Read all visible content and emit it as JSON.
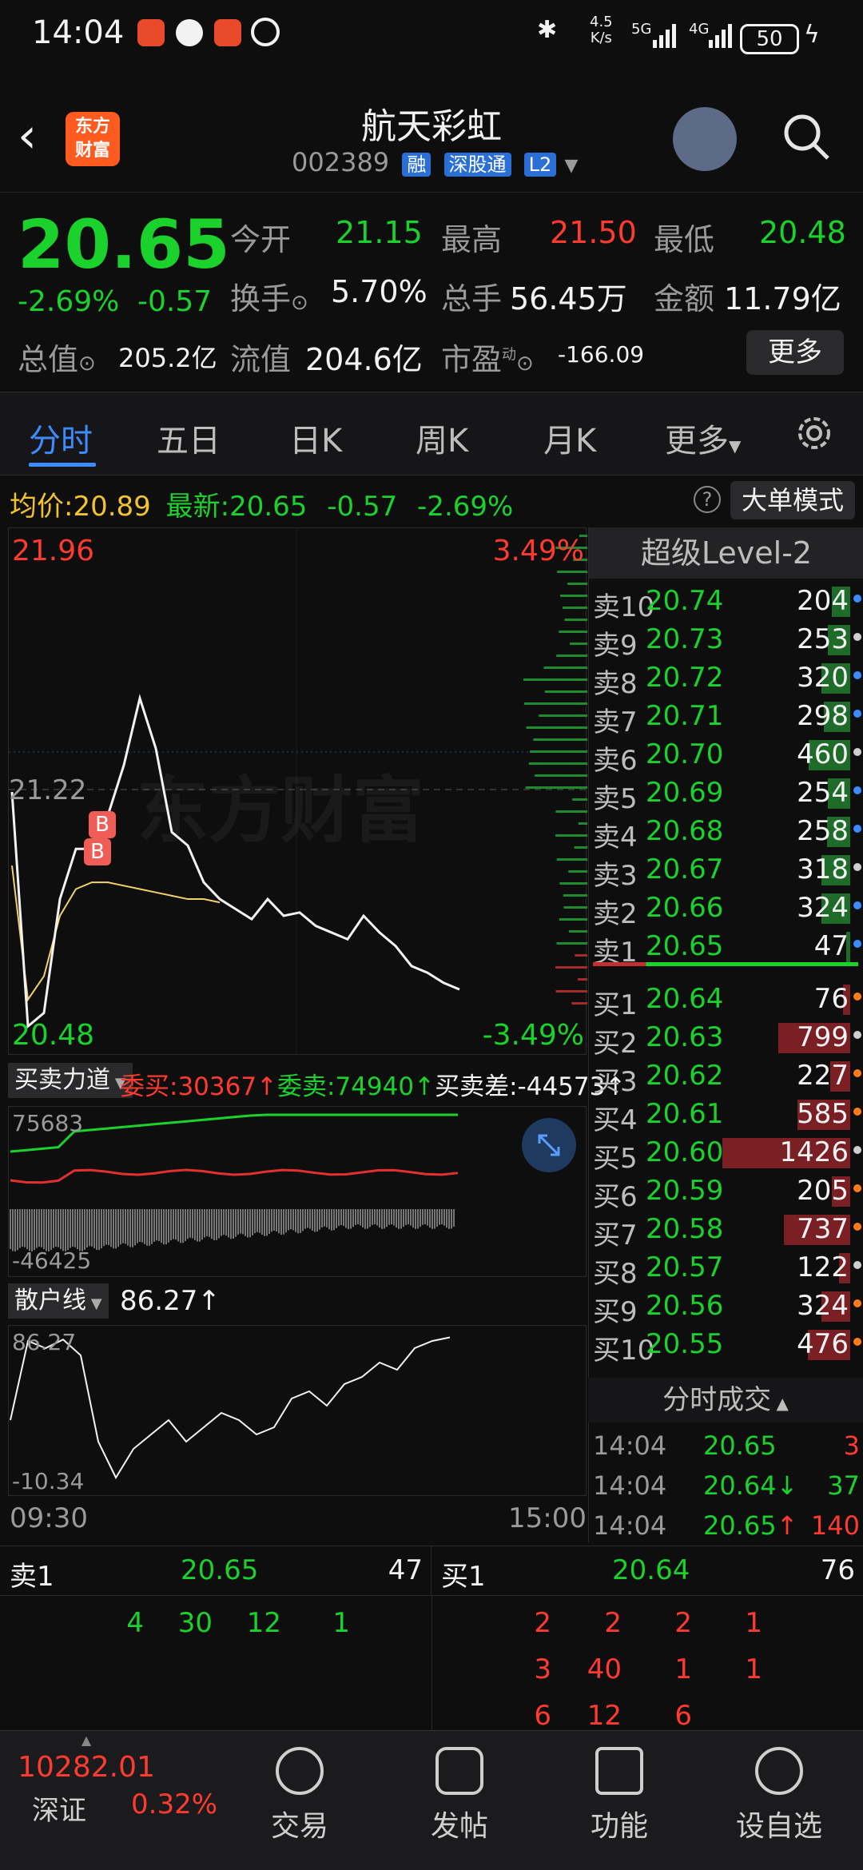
{
  "status_bar": {
    "time": "14:04",
    "speed_value": "4.5",
    "speed_unit": "K/s",
    "net1": "5G",
    "net2": "4G",
    "battery": "50"
  },
  "header": {
    "title": "航天彩虹",
    "code": "002389",
    "tag_rong": "融",
    "tag_sgt": "深股通",
    "tag_level": "L2",
    "logo_line1": "东方",
    "logo_line2": "财富"
  },
  "quote": {
    "price": "20.65",
    "change_pct": "-2.69%",
    "change": "-0.57",
    "open_label": "今开",
    "open": "21.15",
    "high_label": "最高",
    "high": "21.50",
    "low_label": "最低",
    "low": "20.48",
    "turnover_label": "换手",
    "turnover": "5.70%",
    "volume_label": "总手",
    "volume": "56.45万",
    "amount_label": "金额",
    "amount": "11.79亿",
    "mcap_label": "总值",
    "mcap": "205.2亿",
    "float_label": "流值",
    "float": "204.6亿",
    "pe_label": "市盈",
    "pe_sup": "动",
    "pe": "-166.09",
    "more": "更多"
  },
  "tabs": [
    "分时",
    "五日",
    "日K",
    "周K",
    "月K",
    "更多"
  ],
  "infobar": {
    "avg_label": "均价:",
    "avg": "20.89",
    "latest_label": "最新:",
    "latest": "20.65",
    "chg": "-0.57",
    "chg_pct": "-2.69%",
    "mode": "大单模式"
  },
  "chart": {
    "y_max": "21.96",
    "y_min": "20.48",
    "y_mid": "21.22",
    "pct_max": "3.49%",
    "pct_min": "-3.49%",
    "watermark": "东方财富",
    "marker1": "B",
    "marker2": "B",
    "time_start": "09:30",
    "time_end": "15:00",
    "force_label": "买卖力道",
    "wei_buy": "委买:30367↑",
    "wei_sell": "委卖:74940↑",
    "diff": "买卖差:-44573↑",
    "force_max": "75683",
    "force_min": "-46425",
    "retail_label": "散户线",
    "retail_val": "86.27↑",
    "retail_max": "86.27",
    "retail_min": "-10.34"
  },
  "chart_data": {
    "type": "line",
    "x_range": [
      "09:30",
      "15:00"
    ],
    "ylim": [
      20.48,
      21.96
    ],
    "y_mid": 21.22,
    "series": [
      {
        "values": [
          21.22,
          20.52,
          20.56,
          20.9,
          21.05,
          21.05,
          21.15,
          21.3,
          21.5,
          21.35,
          21.1,
          21.06,
          20.95,
          20.9,
          20.87,
          20.84,
          20.9,
          20.85,
          20.86,
          20.82,
          20.8,
          20.78,
          20.85,
          20.8,
          20.76,
          20.7,
          20.68,
          20.65,
          20.63
        ]
      },
      {
        "values": [
          21.0,
          20.6,
          20.67,
          20.85,
          20.93,
          20.95,
          20.95,
          20.94,
          20.93,
          20.92,
          20.91,
          20.9,
          20.9,
          20.89
        ]
      }
    ]
  },
  "orderbook": {
    "title": "超级Level-2",
    "asks": [
      {
        "label": "卖10",
        "price": "20.74",
        "vol": "204"
      },
      {
        "label": "卖9",
        "price": "20.73",
        "vol": "253"
      },
      {
        "label": "卖8",
        "price": "20.72",
        "vol": "320"
      },
      {
        "label": "卖7",
        "price": "20.71",
        "vol": "298"
      },
      {
        "label": "卖6",
        "price": "20.70",
        "vol": "460"
      },
      {
        "label": "卖5",
        "price": "20.69",
        "vol": "254"
      },
      {
        "label": "卖4",
        "price": "20.68",
        "vol": "258"
      },
      {
        "label": "卖3",
        "price": "20.67",
        "vol": "318"
      },
      {
        "label": "卖2",
        "price": "20.66",
        "vol": "324"
      },
      {
        "label": "卖1",
        "price": "20.65",
        "vol": "47"
      }
    ],
    "bids": [
      {
        "label": "买1",
        "price": "20.64",
        "vol": "76"
      },
      {
        "label": "买2",
        "price": "20.63",
        "vol": "799"
      },
      {
        "label": "买3",
        "price": "20.62",
        "vol": "227"
      },
      {
        "label": "买4",
        "price": "20.61",
        "vol": "585"
      },
      {
        "label": "买5",
        "price": "20.60",
        "vol": "1426"
      },
      {
        "label": "买6",
        "price": "20.59",
        "vol": "205"
      },
      {
        "label": "买7",
        "price": "20.58",
        "vol": "737"
      },
      {
        "label": "买8",
        "price": "20.57",
        "vol": "122"
      },
      {
        "label": "买9",
        "price": "20.56",
        "vol": "324"
      },
      {
        "label": "买10",
        "price": "20.55",
        "vol": "476"
      }
    ],
    "trades_title": "分时成交",
    "trades": [
      {
        "time": "14:04",
        "price": "20.65",
        "arrow": "",
        "vol": "3"
      },
      {
        "time": "14:04",
        "price": "20.64",
        "arrow": "↓",
        "vol": "37"
      },
      {
        "time": "14:04",
        "price": "20.65",
        "arrow": "↑",
        "vol": "140"
      }
    ]
  },
  "queue": {
    "sell_label": "卖1",
    "sell_price": "20.65",
    "sell_total": "47",
    "sell_items": [
      "4",
      "30",
      "12",
      "1"
    ],
    "buy_label": "买1",
    "buy_price": "20.64",
    "buy_total": "76",
    "buy_items": [
      "2",
      "2",
      "2",
      "1",
      "3",
      "40",
      "1",
      "1",
      "6",
      "12",
      "6"
    ]
  },
  "footer": {
    "index_value": "10282.01",
    "index_name": "深证",
    "index_pct": "0.32%",
    "items": [
      "交易",
      "发帖",
      "功能",
      "设自选"
    ]
  }
}
